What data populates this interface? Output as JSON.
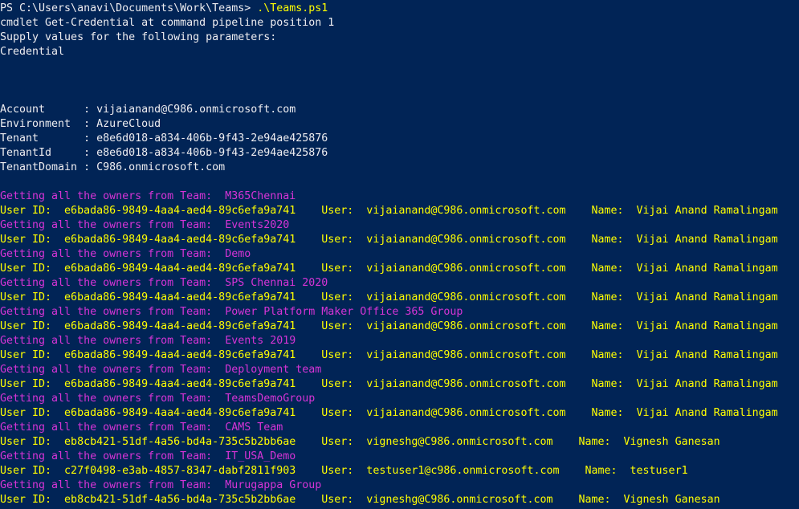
{
  "terminal": {
    "prompt": "PS C:\\Users\\anavi\\Documents\\Work\\Teams> ",
    "command": ".\\Teams.ps1",
    "intro_lines": [
      "cmdlet Get-Credential at command pipeline position 1",
      "Supply values for the following parameters:",
      "Credential"
    ],
    "account_info": [
      "Account      : vijaianand@C986.onmicrosoft.com",
      "Environment  : AzureCloud",
      "Tenant       : e8e6d018-a834-406b-9f43-2e94ae425876",
      "TenantId     : e8e6d018-a834-406b-9f43-2e94ae425876",
      "TenantDomain : C986.onmicrosoft.com"
    ],
    "owner_blocks": [
      {
        "team_line": "Getting all the owners from Team:  M365Chennai",
        "user_line": "User ID:  e6bada86-9849-4aa4-aed4-89c6efa9a741    User:  vijaianand@C986.onmicrosoft.com    Name:  Vijai Anand Ramalingam"
      },
      {
        "team_line": "Getting all the owners from Team:  Events2020",
        "user_line": "User ID:  e6bada86-9849-4aa4-aed4-89c6efa9a741    User:  vijaianand@C986.onmicrosoft.com    Name:  Vijai Anand Ramalingam"
      },
      {
        "team_line": "Getting all the owners from Team:  Demo",
        "user_line": "User ID:  e6bada86-9849-4aa4-aed4-89c6efa9a741    User:  vijaianand@C986.onmicrosoft.com    Name:  Vijai Anand Ramalingam"
      },
      {
        "team_line": "Getting all the owners from Team:  SPS Chennai 2020",
        "user_line": "User ID:  e6bada86-9849-4aa4-aed4-89c6efa9a741    User:  vijaianand@C986.onmicrosoft.com    Name:  Vijai Anand Ramalingam"
      },
      {
        "team_line": "Getting all the owners from Team:  Power Platform Maker Office 365 Group",
        "user_line": "User ID:  e6bada86-9849-4aa4-aed4-89c6efa9a741    User:  vijaianand@C986.onmicrosoft.com    Name:  Vijai Anand Ramalingam"
      },
      {
        "team_line": "Getting all the owners from Team:  Events 2019",
        "user_line": "User ID:  e6bada86-9849-4aa4-aed4-89c6efa9a741    User:  vijaianand@C986.onmicrosoft.com    Name:  Vijai Anand Ramalingam"
      },
      {
        "team_line": "Getting all the owners from Team:  Deployment team",
        "user_line": "User ID:  e6bada86-9849-4aa4-aed4-89c6efa9a741    User:  vijaianand@C986.onmicrosoft.com    Name:  Vijai Anand Ramalingam"
      },
      {
        "team_line": "Getting all the owners from Team:  TeamsDemoGroup",
        "user_line": "User ID:  e6bada86-9849-4aa4-aed4-89c6efa9a741    User:  vijaianand@C986.onmicrosoft.com    Name:  Vijai Anand Ramalingam"
      },
      {
        "team_line": "Getting all the owners from Team:  CAMS Team",
        "user_line": "User ID:  eb8cb421-51df-4a56-bd4a-735c5b2bb6ae    User:  vigneshg@C986.onmicrosoft.com    Name:  Vignesh Ganesan"
      },
      {
        "team_line": "Getting all the owners from Team:  IT_USA_Demo",
        "user_line": "User ID:  c27f0498-e3ab-4857-8347-dabf2811f903    User:  testuser1@c986.onmicrosoft.com    Name:  testuser1"
      },
      {
        "team_line": "Getting all the owners from Team:  Murugappa Group",
        "user_line": "User ID:  eb8cb421-51df-4a56-bd4a-735c5b2bb6ae    User:  vigneshg@C986.onmicrosoft.com    Name:  Vignesh Ganesan"
      }
    ],
    "colors": {
      "background": "#012456",
      "default_text": "#eeedf0",
      "warning_yellow": "#ffff00",
      "team_magenta": "#d634d6"
    }
  }
}
